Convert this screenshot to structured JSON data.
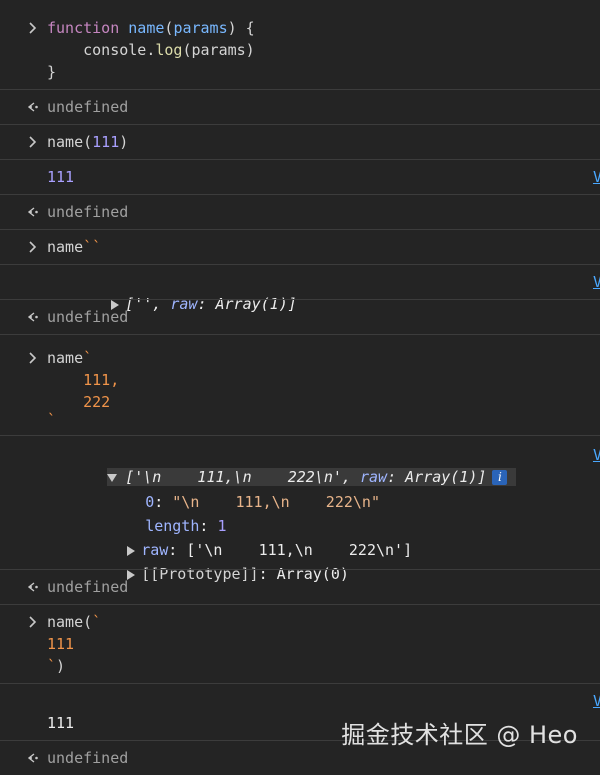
{
  "entries": [
    {
      "kind": "input",
      "lines": [
        "function name(params) {",
        "    console.log(params)",
        "}"
      ]
    },
    {
      "kind": "result",
      "text": "undefined"
    },
    {
      "kind": "input",
      "lines": [
        "name(111)"
      ]
    },
    {
      "kind": "log",
      "text": "111",
      "source": "V"
    },
    {
      "kind": "result",
      "text": "undefined"
    },
    {
      "kind": "input",
      "lines": [
        "name``"
      ]
    },
    {
      "kind": "log_array_collapsed",
      "preview_open": "['', ",
      "preview_raw_key": "raw",
      "preview_raw_val": ": Array(1)]",
      "source": "V"
    },
    {
      "kind": "result",
      "text": "undefined"
    },
    {
      "kind": "input",
      "lines": [
        "name`",
        "    111,",
        "    222",
        "`"
      ]
    },
    {
      "kind": "log_array_expanded",
      "preview_open": "['\\n    111,\\n    222\\n', ",
      "preview_raw_key": "raw",
      "preview_raw_val": ": Array(1)]",
      "info": "i",
      "props": [
        {
          "key": "0",
          "sep": ": ",
          "value": "\"\\n    111,\\n    222\\n\""
        },
        {
          "key": "length",
          "sep": ": ",
          "value": "1"
        },
        {
          "key": "raw",
          "sep": ": ",
          "value": "['\\n    111,\\n    222\\n']"
        },
        {
          "key": "[[Prototype]]",
          "sep": ": ",
          "value": "Array(0)"
        }
      ],
      "source": "V"
    },
    {
      "kind": "result",
      "text": "undefined"
    },
    {
      "kind": "input",
      "lines": [
        "name(`",
        "111",
        "`)"
      ]
    },
    {
      "kind": "log",
      "text": "111",
      "source": "V"
    },
    {
      "kind": "result",
      "text": "undefined"
    }
  ],
  "watermark": "掘金技术社区 @ Heo",
  "icons": {
    "input": "chevron-right-icon",
    "result": "return-arrow-icon",
    "expand": "triangle-icon",
    "info": "info-icon"
  },
  "colors": {
    "background": "#242424",
    "keyword": "#c586c0",
    "function": "#79b8ff",
    "number": "#a9a0ff",
    "template": "#f0944a",
    "link": "#4aa8ff"
  }
}
